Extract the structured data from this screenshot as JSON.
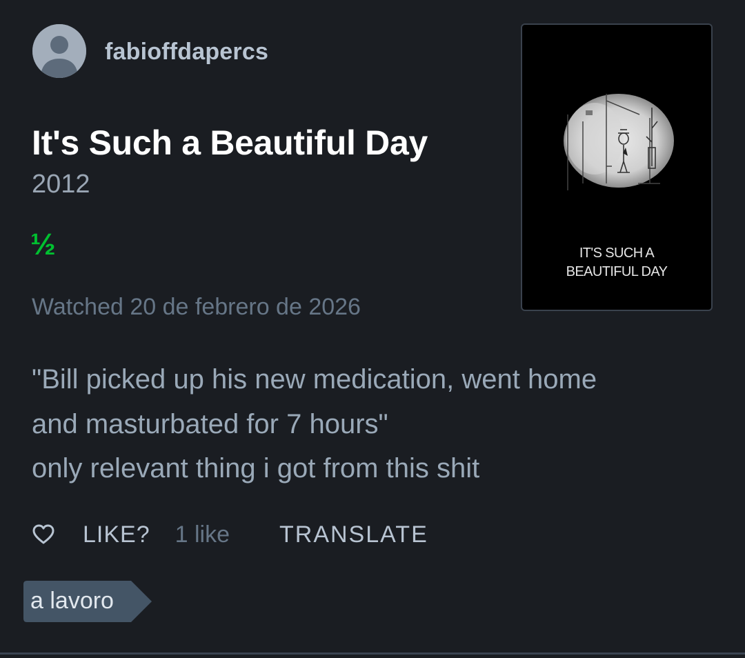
{
  "review": {
    "username": "fabioffdapercs",
    "film_title": "It's Such a Beautiful Day",
    "film_year": "2012",
    "rating": "½",
    "watched_text": "Watched 20 de febrero de 2026",
    "text_lines": [
      "\"Bill picked up his new medication, went home",
      "and masturbated for 7 hours\"",
      "only relevant thing i got from this shit"
    ]
  },
  "poster": {
    "title_lines": [
      "IT'S SUCH A",
      "BEAUTIFUL DAY"
    ]
  },
  "actions": {
    "like_label": "LIKE?",
    "like_count": "1 like",
    "translate_label": "TRANSLATE"
  },
  "tags": [
    "a lavoro"
  ],
  "icons": {
    "avatar": "user-avatar-icon",
    "like": "heart-outline-icon"
  },
  "colors": {
    "background": "#1a1d22",
    "rating_green": "#00c030",
    "muted_text": "#667687",
    "body_text": "#9aa9b8",
    "tag_background": "#445566"
  }
}
